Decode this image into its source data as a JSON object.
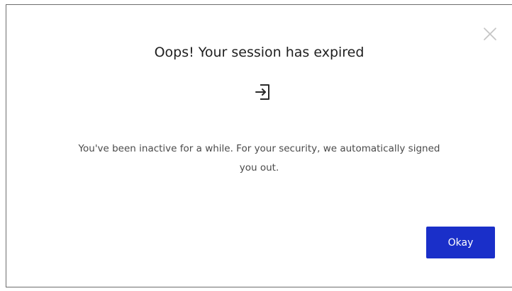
{
  "dialog": {
    "title": "Oops! Your session has expired",
    "title_icon": "sign-in-icon",
    "message": "You've been inactive for a while. For your security, we automatically signed you out.",
    "close_icon": "close-icon",
    "okay_label": "Okay"
  },
  "colors": {
    "primary_button": "#1a2fc9",
    "title_text": "#1f1f1f",
    "body_text": "#4a4a4a",
    "close_icon": "#c4c4c4",
    "border": "#6d6d6d"
  }
}
